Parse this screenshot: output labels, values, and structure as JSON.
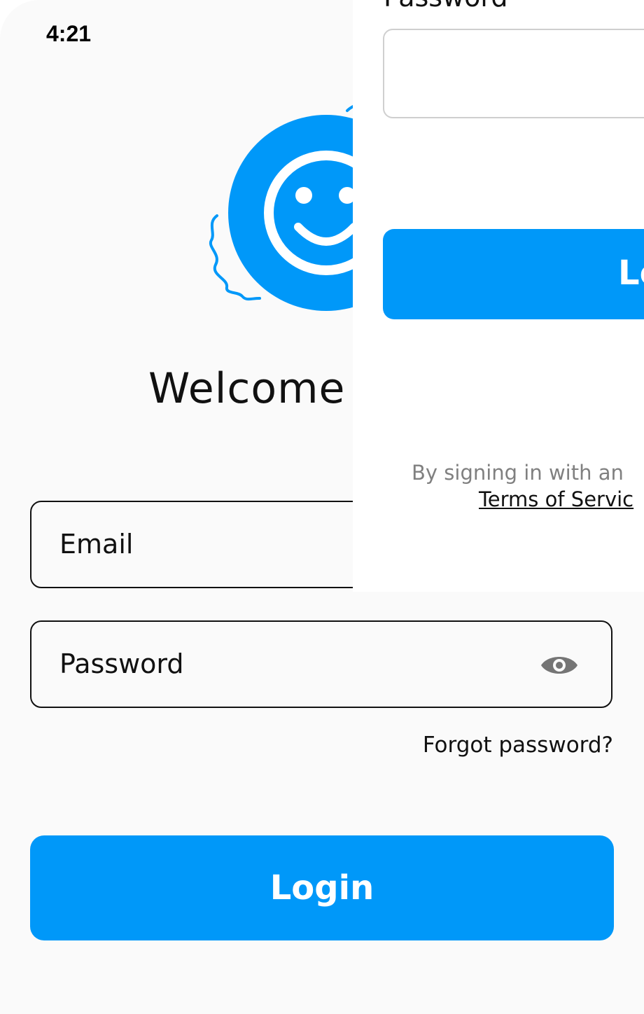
{
  "status_bar": {
    "time": "4:21"
  },
  "logo": {
    "icon": "smiley-face-icon",
    "color": "#0098f9"
  },
  "welcome": {
    "text": "Welcome"
  },
  "email_field": {
    "placeholder": "Email"
  },
  "password_field": {
    "placeholder": "Password",
    "toggle_icon": "eye-icon"
  },
  "forgot_password": {
    "label": "Forgot password?"
  },
  "login_button": {
    "label": "Login",
    "color": "#0098f9"
  },
  "overlay": {
    "password_label": "Password",
    "login_button_label": "Lo",
    "legal_text": "By signing in with an",
    "terms_link": "Terms of Servic"
  }
}
